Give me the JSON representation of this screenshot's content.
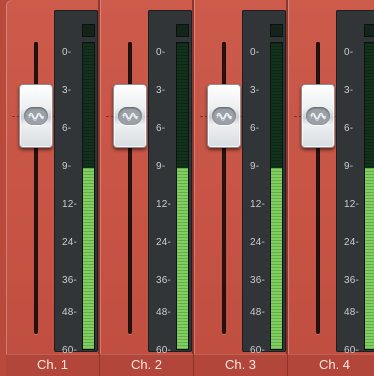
{
  "scale_labels": [
    "0-",
    "3-",
    "6-",
    "9-",
    "12-",
    "24-",
    "36-",
    "48-",
    "60-"
  ],
  "channels": [
    {
      "name": "Ch. 1",
      "meter_level": 0.59,
      "fader_logo": "wave-logo-icon"
    },
    {
      "name": "Ch. 2",
      "meter_level": 0.59,
      "fader_logo": "wave-logo-icon"
    },
    {
      "name": "Ch. 3",
      "meter_level": 0.59,
      "fader_logo": "wave-logo-icon"
    },
    {
      "name": "Ch. 4",
      "meter_level": 0.59,
      "fader_logo": "wave-logo-icon"
    }
  ],
  "colors": {
    "strip": "#c75445",
    "meter_bg": "#323538",
    "meter_fill": "#7fd05e",
    "meter_empty": "#12321c",
    "label_text": "#c9cdd1"
  }
}
